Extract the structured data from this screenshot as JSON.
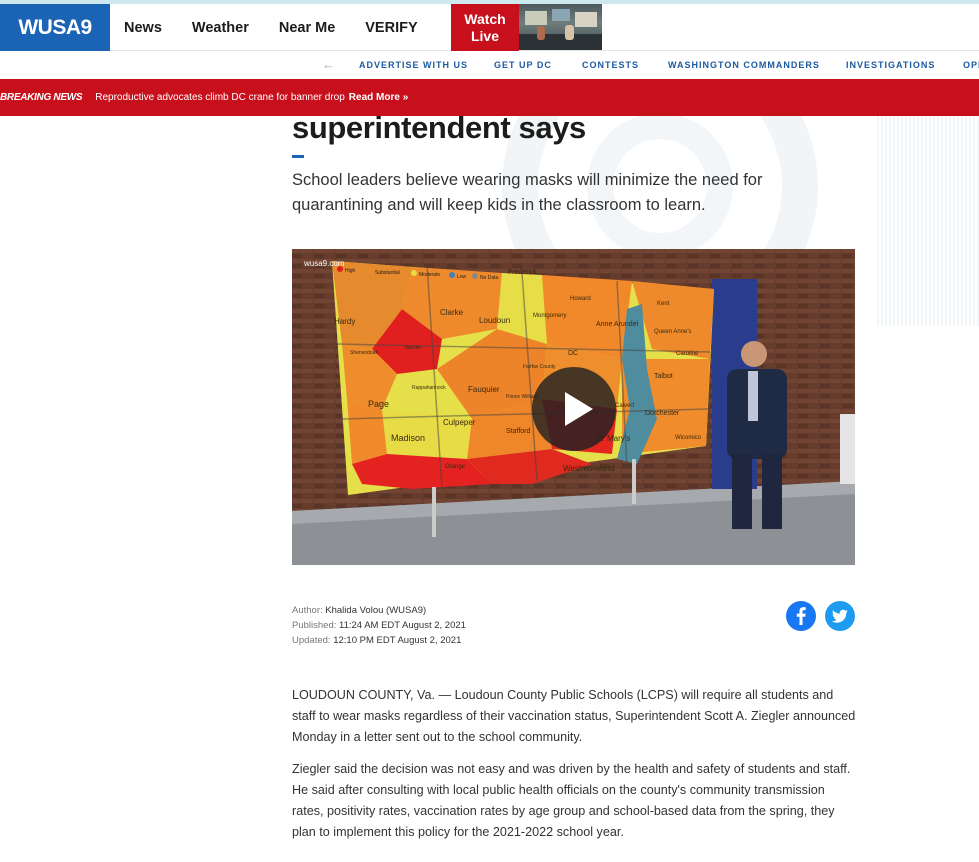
{
  "site": {
    "logo_text": "WUSA9",
    "brand_color": "#1b63b4",
    "breaking_color": "#c8101c"
  },
  "nav": {
    "items": [
      "News",
      "Weather",
      "Near Me",
      "VERIFY"
    ],
    "watch_live": "Watch Live"
  },
  "subnav": {
    "items": [
      "ADVERTISE WITH US",
      "GET UP DC",
      "CONTESTS",
      "WASHINGTON COMMANDERS",
      "INVESTIGATIONS",
      "OPI"
    ]
  },
  "breaking": {
    "label": "BREAKING NEWS",
    "text": "Reproductive advocates climb DC crane for banner drop",
    "more": "Read More »"
  },
  "article": {
    "headline_tail": "superintendent says",
    "summary": "School leaders believe wearing masks will minimize the need for quarantining and will keep kids in the classroom to learn.",
    "video": {
      "watermark": "wusa9.com",
      "legend": [
        "High",
        "Substantial",
        "Moderate",
        "Low",
        "No Data"
      ],
      "map_labels": [
        "Hardy",
        "Clarke",
        "Loudoun",
        "Montgomery",
        "Howard",
        "Anne Arundel",
        "Frederick",
        "Kent",
        "Queen Anne's",
        "Shenandoah",
        "Warren",
        "Fauquier",
        "DC",
        "Fairfax County",
        "Prince William",
        "Talbot",
        "Caroline",
        "Page",
        "Rappahannock",
        "Culpeper",
        "Stafford",
        "Calvert",
        "Dorchester",
        "Madison",
        "Orange",
        "St. Mary's",
        "Westmoreland",
        "Wicomico"
      ]
    },
    "author_label": "Author:",
    "author": "Khalida Volou (WUSA9)",
    "published_label": "Published:",
    "published": "11:24 AM EDT August 2, 2021",
    "updated_label": "Updated:",
    "updated": "12:10 PM EDT August 2, 2021",
    "share": {
      "facebook_icon": "facebook-icon",
      "twitter_icon": "twitter-icon"
    },
    "paragraphs": [
      "LOUDOUN COUNTY, Va. — Loudoun County Public Schools (LCPS) will require all students and staff to wear masks regardless of their vaccination status, Superintendent Scott A. Ziegler announced Monday in a letter sent out to the school community.",
      "Ziegler said the decision was not easy and was driven by the health and safety of students and staff. He said after consulting with local public health officials on the county's community transmission rates, positivity rates, vaccination rates by age group and school-based data from the spring, they plan to implement this policy for the 2021-2022 school year."
    ]
  }
}
